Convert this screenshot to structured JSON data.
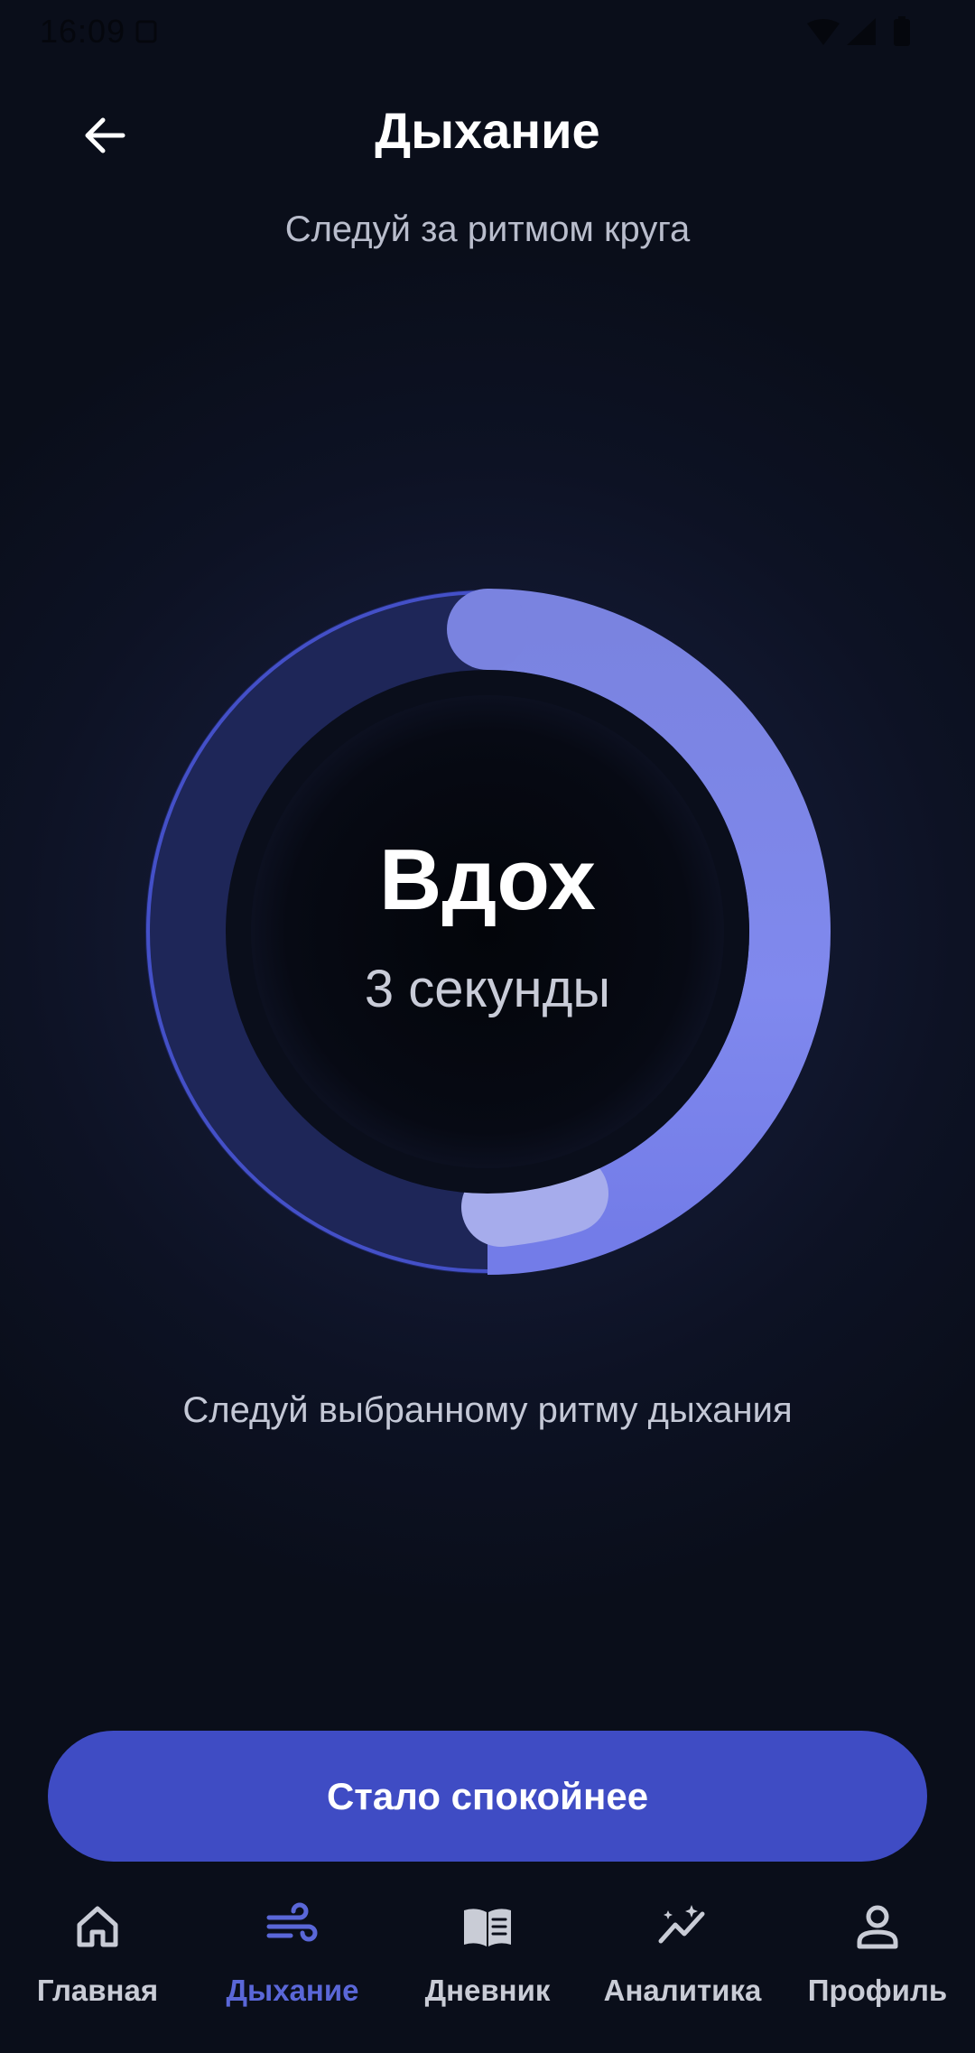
{
  "status_bar": {
    "time": "16:09"
  },
  "header": {
    "title": "Дыхание",
    "subtitle": "Следуй за ритмом круга"
  },
  "breathing": {
    "phase": "Вдох",
    "duration": "3 секунды",
    "hint": "Следуй выбранному ритму дыхания"
  },
  "cta": {
    "label": "Стало спокойнее"
  },
  "bottom_nav": {
    "items": [
      {
        "label": "Главная",
        "icon": "home-icon"
      },
      {
        "label": "Дыхание",
        "icon": "wind-icon"
      },
      {
        "label": "Дневник",
        "icon": "book-icon"
      },
      {
        "label": "Аналитика",
        "icon": "analytics-icon"
      },
      {
        "label": "Профиль",
        "icon": "profile-icon"
      }
    ]
  },
  "colors": {
    "background": "#0a0e1a",
    "accent": "#3f4cc4",
    "active_nav": "#5a67d8",
    "ring_track": "#1d2660",
    "ring_progress": "#7b85e6"
  }
}
